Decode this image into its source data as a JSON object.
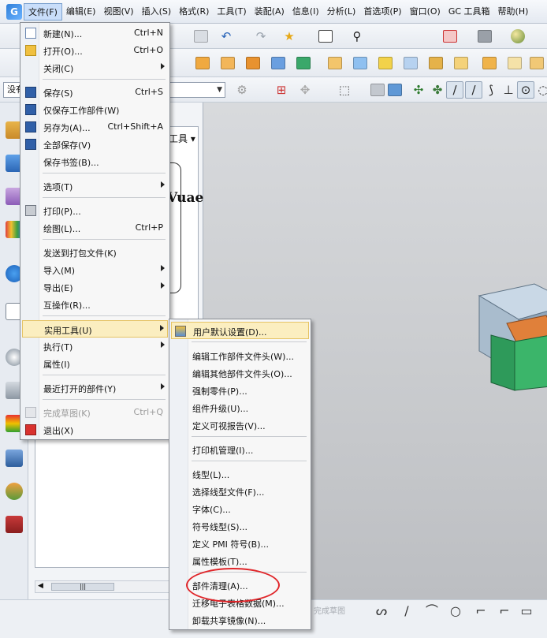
{
  "menubar": {
    "items": [
      "文件(F)",
      "编辑(E)",
      "视图(V)",
      "插入(S)",
      "格式(R)",
      "工具(T)",
      "装配(A)",
      "信息(I)",
      "分析(L)",
      "首选项(P)",
      "窗口(O)",
      "GC 工具箱",
      "帮助(H)"
    ]
  },
  "toolbar": {
    "selector_value": "没有"
  },
  "navigator": {
    "tools_label": "工具",
    "bracket_text": "Vuae"
  },
  "file_menu": {
    "items": [
      {
        "label": "新建(N)...",
        "shortcut": "Ctrl+N"
      },
      {
        "label": "打开(O)...",
        "shortcut": "Ctrl+O"
      },
      {
        "label": "关闭(C)",
        "shortcut": ""
      },
      {
        "label": "保存(S)",
        "shortcut": "Ctrl+S"
      },
      {
        "label": "仅保存工作部件(W)",
        "shortcut": ""
      },
      {
        "label": "另存为(A)...",
        "shortcut": "Ctrl+Shift+A"
      },
      {
        "label": "全部保存(V)",
        "shortcut": ""
      },
      {
        "label": "保存书签(B)...",
        "shortcut": ""
      },
      {
        "label": "选项(T)",
        "shortcut": ""
      },
      {
        "label": "打印(P)...",
        "shortcut": ""
      },
      {
        "label": "绘图(L)...",
        "shortcut": "Ctrl+P"
      },
      {
        "label": "发送到打包文件(K)",
        "shortcut": ""
      },
      {
        "label": "导入(M)",
        "shortcut": ""
      },
      {
        "label": "导出(E)",
        "shortcut": ""
      },
      {
        "label": "互操作(R)...",
        "shortcut": ""
      },
      {
        "label": "实用工具(U)",
        "shortcut": ""
      },
      {
        "label": "执行(T)",
        "shortcut": ""
      },
      {
        "label": "属性(I)",
        "shortcut": ""
      },
      {
        "label": "最近打开的部件(Y)",
        "shortcut": ""
      },
      {
        "label": "完成草图(K)",
        "shortcut": "Ctrl+Q"
      },
      {
        "label": "退出(X)",
        "shortcut": ""
      }
    ]
  },
  "utilities_menu": {
    "items": [
      "用户默认设置(D)...",
      "编辑工作部件文件头(W)...",
      "编辑其他部件文件头(O)...",
      "强制零件(P)...",
      "组件升级(U)...",
      "定义可视报告(V)...",
      "打印机管理(I)...",
      "线型(L)...",
      "选择线型文件(F)...",
      "字体(C)...",
      "符号线型(S)...",
      "定义 PMI 符号(B)...",
      "属性模板(T)...",
      "部件清理(A)...",
      "迁移电子表格数据(M)...",
      "卸载共享镜像(N)..."
    ]
  },
  "statusbar": {
    "finish_sketch": "完成草图"
  },
  "colors": {
    "highlight": "#fbeec0",
    "annotation_circle": "#e0262a",
    "menubar_active": "#c9defa"
  }
}
